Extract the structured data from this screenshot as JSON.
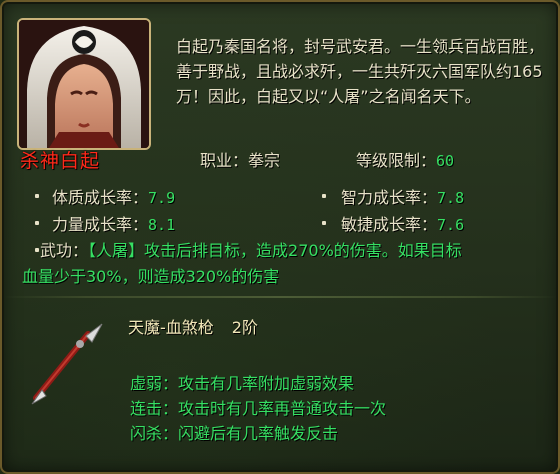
{
  "hero": {
    "name": "杀神白起",
    "bio": "白起乃秦国名将，封号武安君。一生领兵百战百胜，善于野战，且战必求歼，一生共歼灭六国军队约165万！因此，白起又以“人屠”之名闻名天下。",
    "job_label": "职业：",
    "job_value": "拳宗",
    "level_limit_label": "等级限制：",
    "level_limit_value": "60"
  },
  "growth": [
    {
      "label": "体质成长率：",
      "value": "7.9"
    },
    {
      "label": "智力成长率：",
      "value": "7.8"
    },
    {
      "label": "力量成长率：",
      "value": "8.1"
    },
    {
      "label": "敏捷成长率：",
      "value": "7.6"
    }
  ],
  "skill": {
    "label": "武功：",
    "name": "【人屠】",
    "desc_line1": "攻击后排目标，造成270%的伤害。如果目标",
    "desc_line2": "血量少于30%，则造成320%的伤害"
  },
  "weapon": {
    "name": "天魔-血煞枪",
    "level": "2阶",
    "icon": "spear-icon",
    "effects": [
      {
        "label": "虚弱：",
        "text": "攻击有几率附加虚弱效果"
      },
      {
        "label": "连击：",
        "text": "攻击时有几率再普通攻击一次"
      },
      {
        "label": "闪杀：",
        "text": "闪避后有几率触发反击"
      }
    ]
  },
  "colors": {
    "hero_name": "#ff2a1a",
    "value_green": "#36e063",
    "text": "#e8e2c8",
    "border_gold": "#c9b37a"
  }
}
